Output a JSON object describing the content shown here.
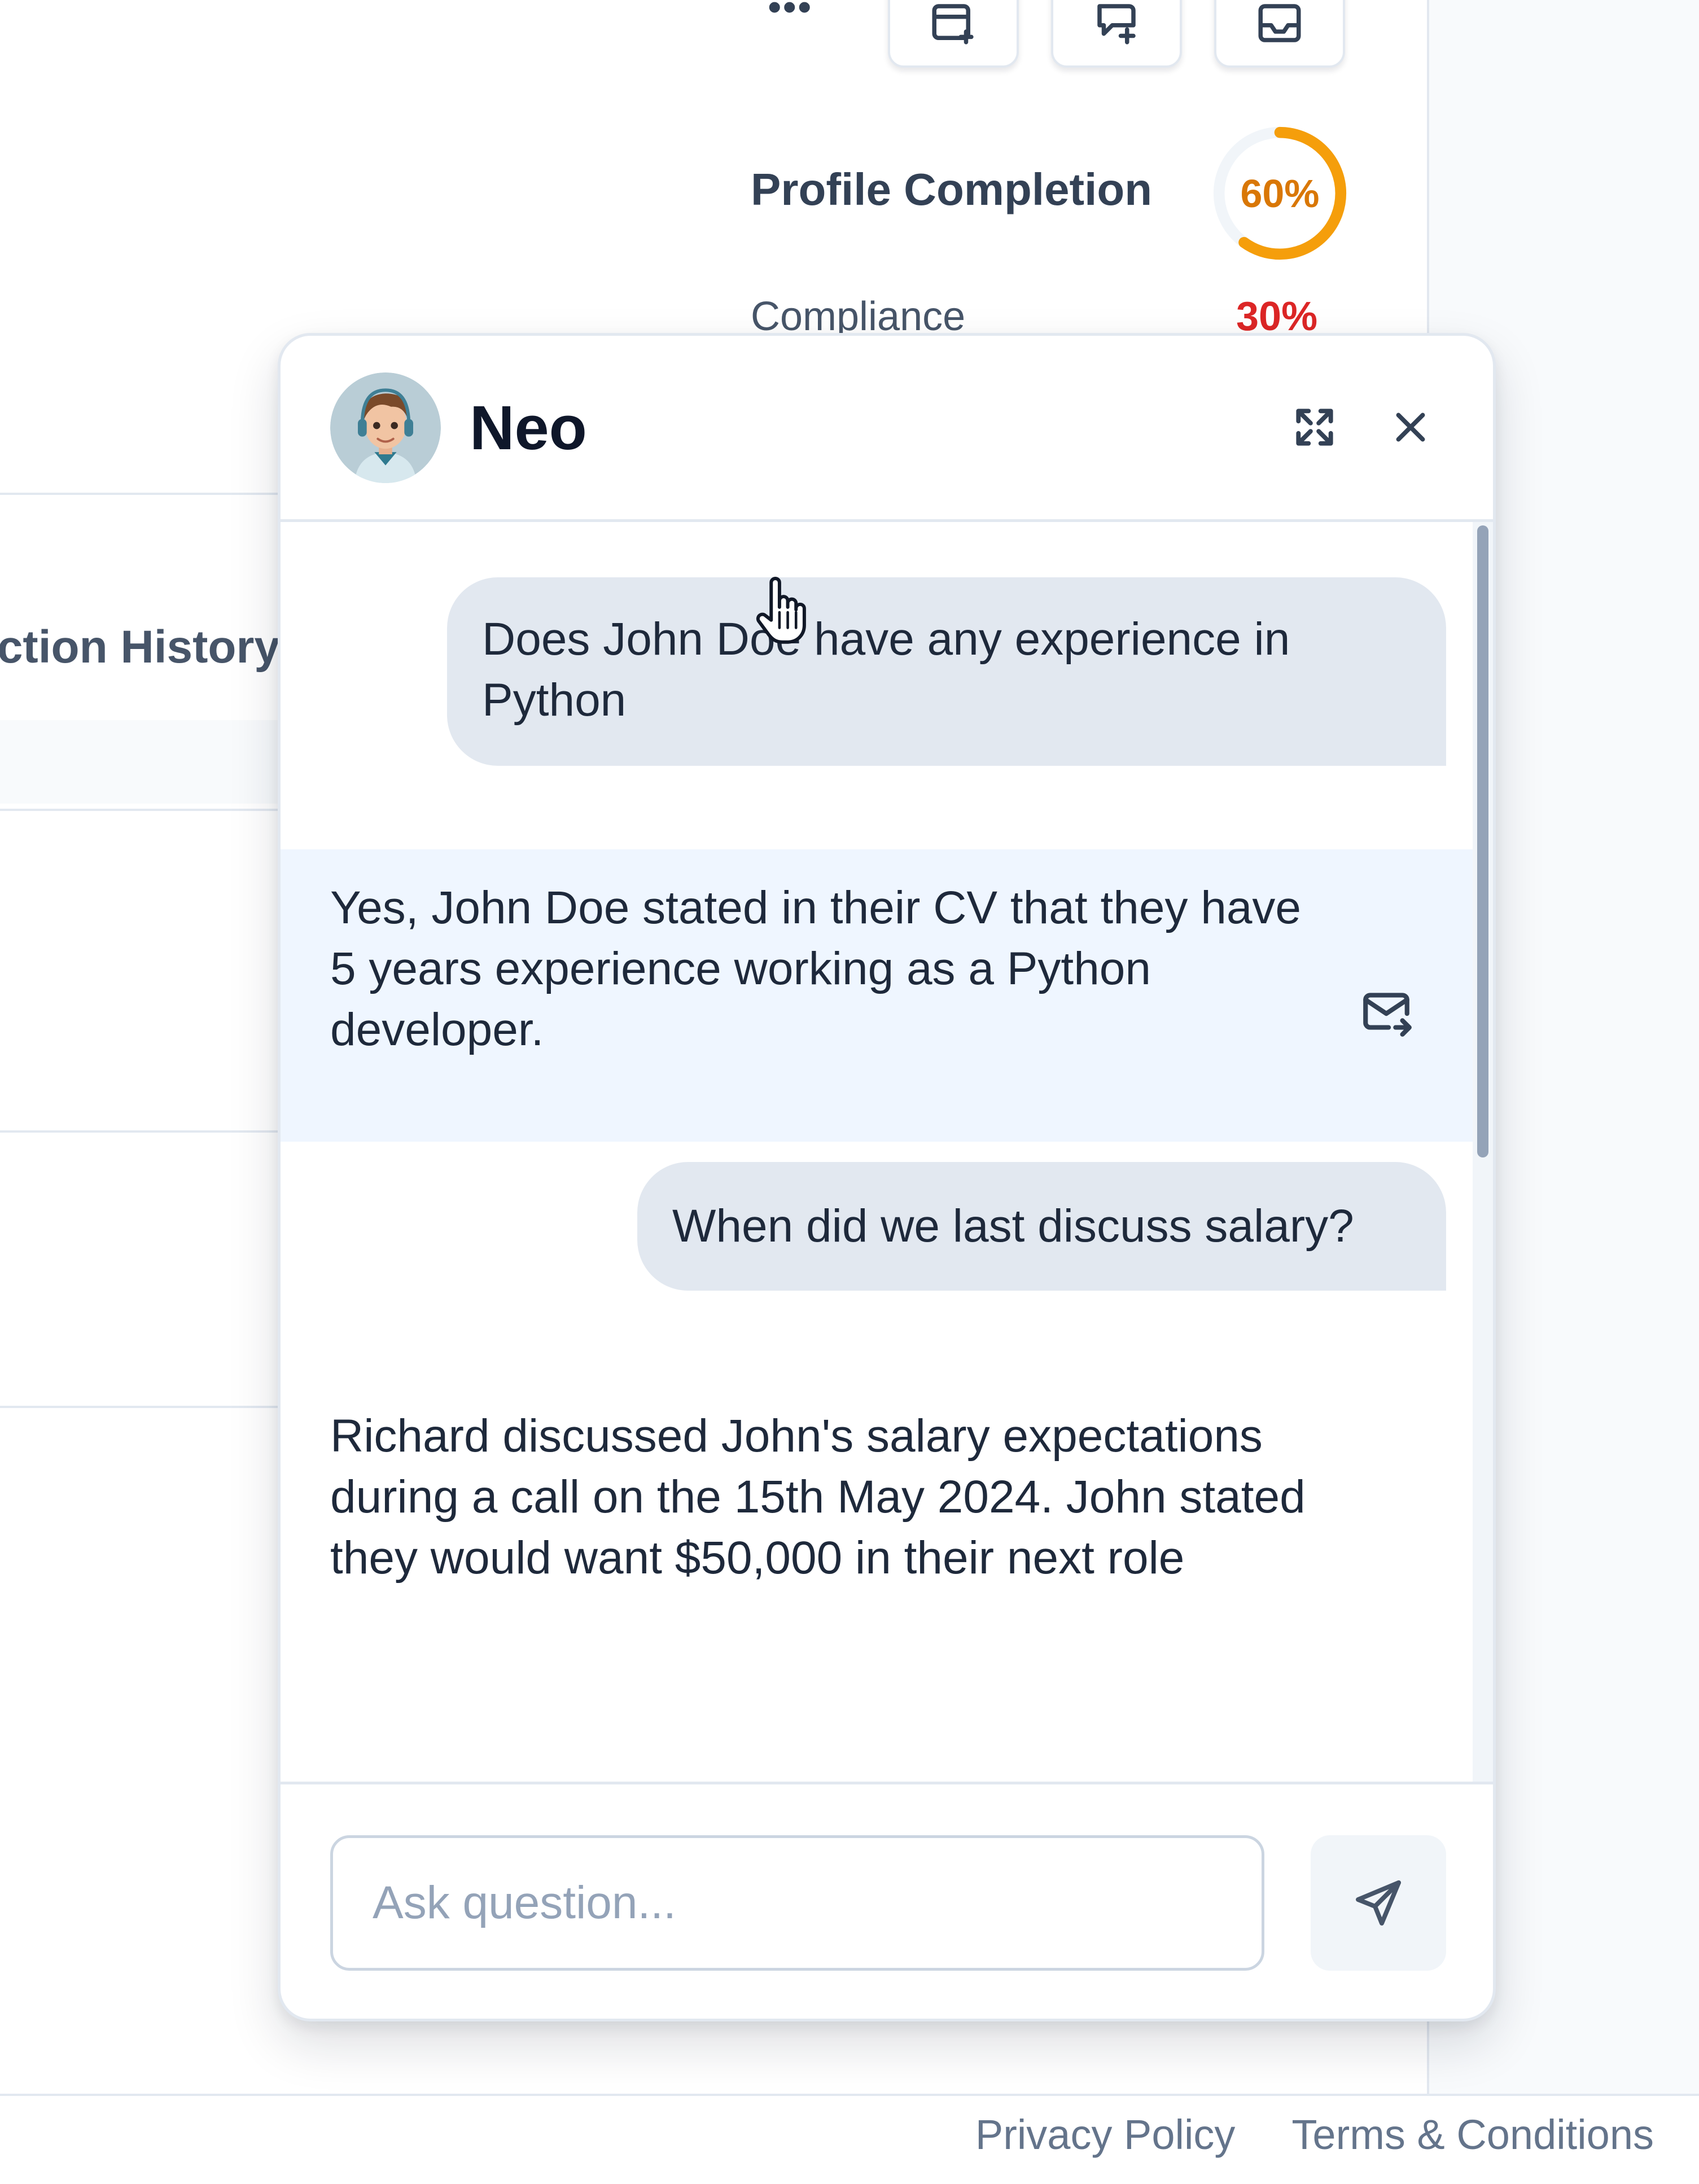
{
  "page": {
    "toolbar_icons": [
      "calendar-add-icon",
      "chat-add-icon",
      "inbox-icon"
    ],
    "more_icon": "more-dots-icon",
    "profile_completion": {
      "label": "Profile Completion",
      "value_text": "60%",
      "value": 0.6,
      "color": "#f59e0b"
    },
    "compliance": {
      "label": "Compliance",
      "value_text": "30%",
      "color": "#dc2626"
    },
    "tab_partial_label": "Interaction History"
  },
  "chat": {
    "title": "Neo",
    "header_icons": [
      "expand-icon",
      "close-icon"
    ],
    "messages": [
      {
        "role": "user",
        "text": "Does John Doe have any experience in Python"
      },
      {
        "role": "assistant",
        "text": "Yes, John Doe stated in their CV that they have 5 years experience working as a Python developer.",
        "action_icon": "mail-forward-icon"
      },
      {
        "role": "user",
        "text": "When did we last discuss salary?"
      },
      {
        "role": "assistant",
        "text": "Richard discussed John's salary expectations during a call on the 15th May 2024. John stated they would want $50,000 in their next role"
      }
    ],
    "input": {
      "value": "",
      "placeholder": "Ask question..."
    },
    "send_icon": "send-icon"
  },
  "footer": {
    "links": [
      "Privacy Policy",
      "Terms & Conditions"
    ]
  },
  "colors": {
    "accent_orange": "#f59e0b",
    "alert_red": "#dc2626",
    "highlight_blue": "#eff6ff",
    "user_bubble": "#e2e8f0"
  }
}
